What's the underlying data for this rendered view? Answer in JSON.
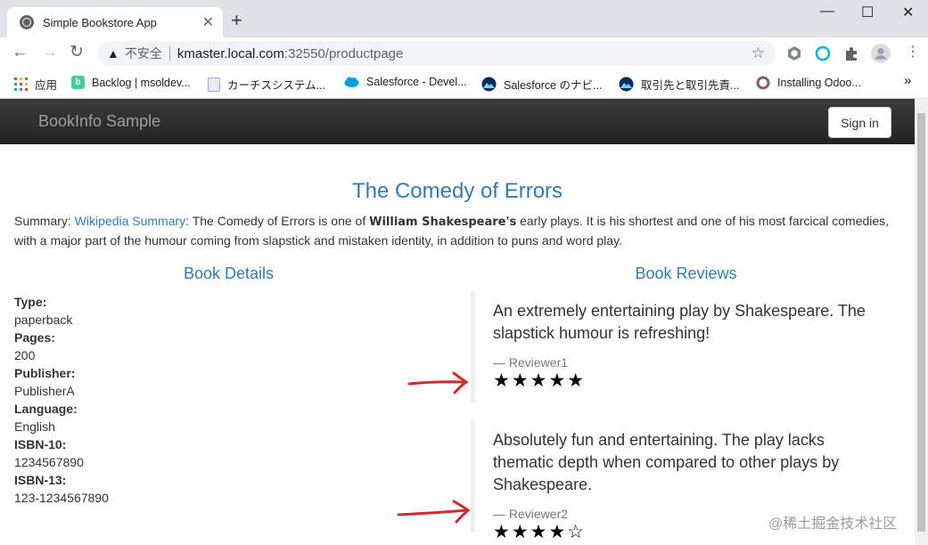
{
  "browser": {
    "tab_title": "Simple Bookstore App",
    "tab_close": "✕",
    "new_tab": "+",
    "window_controls": {
      "minimize": "—",
      "maximize": "☐",
      "close": "✕"
    },
    "security_label": "不安全",
    "url_host": "kmaster.local.com",
    "url_path": ":32550/productpage",
    "bookmarks": [
      {
        "label": "应用",
        "icon": "apps-grid-icon",
        "color": "#ea4335"
      },
      {
        "label": "Backlog | msoldev...",
        "icon": "backlog-icon",
        "color": "#42ce9f"
      },
      {
        "label": "カーチスシステム...",
        "icon": "document-icon",
        "color": "#8ab4f8"
      },
      {
        "label": "Salesforce - Devel...",
        "icon": "salesforce-cloud-icon",
        "color": "#00a1e0"
      },
      {
        "label": "Salesforce のナビ...",
        "icon": "trailhead-icon",
        "color": "#032d60"
      },
      {
        "label": "取引先と取引先責...",
        "icon": "trailhead-icon",
        "color": "#032d60"
      },
      {
        "label": "Installing Odoo...",
        "icon": "odoo-icon",
        "color": "#875a7b"
      }
    ],
    "bookmarks_more": "»"
  },
  "app": {
    "brand": "BookInfo Sample",
    "sign_in": "Sign in",
    "book_title": "The Comedy of Errors",
    "summary": {
      "prefix": "Summary: ",
      "link": "Wikipedia Summary",
      "text_before_bold": ": The Comedy of Errors is one of ",
      "bold": "William Shakespeare's",
      "text_after_bold": " early plays. It is his shortest and one of his most farcical comedies, with a major part of the humour coming from slapstick and mistaken identity, in addition to puns and word play."
    },
    "details_heading": "Book Details",
    "reviews_heading": "Book Reviews",
    "details": [
      {
        "label": "Type:",
        "value": "paperback"
      },
      {
        "label": "Pages:",
        "value": "200"
      },
      {
        "label": "Publisher:",
        "value": "PublisherA"
      },
      {
        "label": "Language:",
        "value": "English"
      },
      {
        "label": "ISBN-10:",
        "value": "1234567890"
      },
      {
        "label": "ISBN-13:",
        "value": "123-1234567890"
      }
    ],
    "reviews": [
      {
        "text": "An extremely entertaining play by Shakespeare. The slapstick humour is refreshing!",
        "author": "— Reviewer1",
        "stars": "★★★★★",
        "rating": 5
      },
      {
        "text": "Absolutely fun and entertaining. The play lacks thematic depth when compared to other plays by Shakespeare.",
        "author": "— Reviewer2",
        "stars": "★★★★☆",
        "rating": 4
      }
    ]
  },
  "annotation": {
    "arrow_color": "#d42a2a"
  },
  "watermark": "@稀土掘金技术社区"
}
